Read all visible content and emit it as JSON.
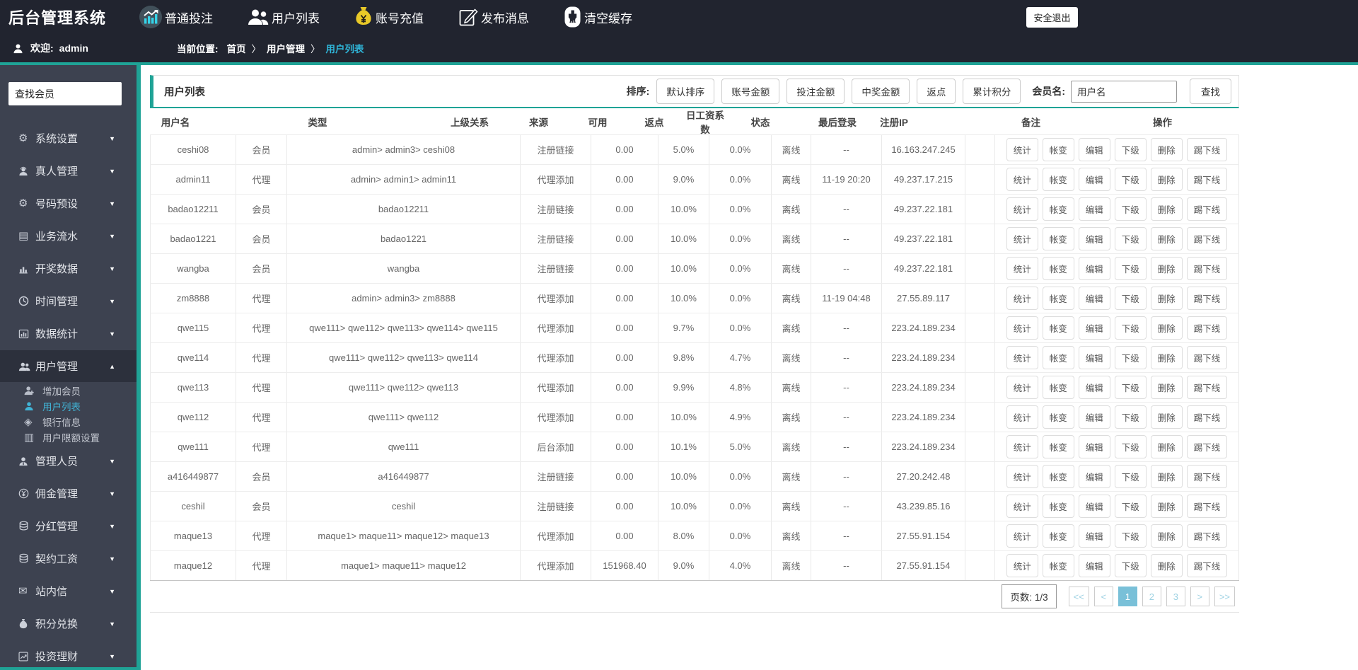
{
  "app": {
    "title": "后台管理系统",
    "logout": "安全退出"
  },
  "topnav": [
    {
      "label": "普通投注",
      "icon": "bet-chart-icon"
    },
    {
      "label": "用户列表",
      "icon": "users-icon"
    },
    {
      "label": "账号充值",
      "icon": "recharge-icon"
    },
    {
      "label": "发布消息",
      "icon": "publish-icon"
    },
    {
      "label": "清空缓存",
      "icon": "cache-icon"
    }
  ],
  "welcome": {
    "icon": "user-icon",
    "label": "欢迎:",
    "user": "admin"
  },
  "breadcrumb": {
    "label": "当前位置:",
    "separator": "〉",
    "items": [
      {
        "label": "首页"
      },
      {
        "label": "用户管理"
      },
      {
        "label": "用户列表",
        "active": true
      }
    ]
  },
  "sidebar": {
    "search_value": "查找会员",
    "menu": [
      {
        "label": "系统设置",
        "icon": "gear-icon",
        "arrow": "▼"
      },
      {
        "label": "真人管理",
        "icon": "live-person-icon",
        "arrow": "▼"
      },
      {
        "label": "号码预设",
        "icon": "gear-outline-icon",
        "arrow": "▼"
      },
      {
        "label": "业务流水",
        "icon": "ledger-icon",
        "arrow": "▼"
      },
      {
        "label": "开奖数据",
        "icon": "podium-chart-icon",
        "arrow": "▼"
      },
      {
        "label": "时间管理",
        "icon": "clock-icon",
        "arrow": "▼"
      },
      {
        "label": "数据统计",
        "icon": "stats-chart-icon",
        "arrow": "▼"
      },
      {
        "label": "用户管理",
        "icon": "people-icon",
        "arrow": "▲",
        "active": true,
        "children": [
          {
            "label": "增加会员",
            "icon": "person-plus-icon"
          },
          {
            "label": "用户列表",
            "icon": "person-icon",
            "active": true
          },
          {
            "label": "银行信息",
            "icon": "bank-diamond-icon"
          },
          {
            "label": "用户限额设置",
            "icon": "doc-limit-icon"
          }
        ]
      },
      {
        "label": "管理人员",
        "icon": "admin-person-icon",
        "arrow": "▼"
      },
      {
        "label": "佣金管理",
        "icon": "yen-circle-icon",
        "arrow": "▼"
      },
      {
        "label": "分红管理",
        "icon": "coins-icon",
        "arrow": "▼"
      },
      {
        "label": "契约工资",
        "icon": "coins2-icon",
        "arrow": "▼"
      },
      {
        "label": "站内信",
        "icon": "mail-icon",
        "arrow": "▼"
      },
      {
        "label": "积分兑换",
        "icon": "moneybag-icon",
        "arrow": "▼"
      },
      {
        "label": "投资理财",
        "icon": "trend-chart-icon",
        "arrow": "▼"
      }
    ]
  },
  "panel": {
    "title": "用户列表",
    "sort_label": "排序:",
    "sort_buttons": [
      "默认排序",
      "账号金额",
      "投注金额",
      "中奖金额",
      "返点",
      "累计积分"
    ],
    "member_label": "会员名:",
    "member_input_value": "用户名",
    "search_button": "查找"
  },
  "table": {
    "columns": [
      "用户名",
      "类型",
      "上级关系",
      "来源",
      "可用",
      "返点",
      "日工资系数",
      "状态",
      "最后登录",
      "注册IP",
      "备注",
      "操作"
    ],
    "action_buttons": [
      "统计",
      "帐变",
      "编辑",
      "下级",
      "删除",
      "踢下线"
    ],
    "rows": [
      [
        "ceshi08",
        "会员",
        "admin> admin3> ceshi08",
        "注册链接",
        "0.00",
        "5.0%",
        "0.0%",
        "离线",
        "--",
        "16.163.247.245",
        ""
      ],
      [
        "admin11",
        "代理",
        "admin> admin1> admin11",
        "代理添加",
        "0.00",
        "9.0%",
        "0.0%",
        "离线",
        "11-19 20:20",
        "49.237.17.215",
        ""
      ],
      [
        "badao12211",
        "会员",
        "badao12211",
        "注册链接",
        "0.00",
        "10.0%",
        "0.0%",
        "离线",
        "--",
        "49.237.22.181",
        ""
      ],
      [
        "badao1221",
        "会员",
        "badao1221",
        "注册链接",
        "0.00",
        "10.0%",
        "0.0%",
        "离线",
        "--",
        "49.237.22.181",
        ""
      ],
      [
        "wangba",
        "会员",
        "wangba",
        "注册链接",
        "0.00",
        "10.0%",
        "0.0%",
        "离线",
        "--",
        "49.237.22.181",
        ""
      ],
      [
        "zm8888",
        "代理",
        "admin> admin3> zm8888",
        "代理添加",
        "0.00",
        "10.0%",
        "0.0%",
        "离线",
        "11-19 04:48",
        "27.55.89.117",
        ""
      ],
      [
        "qwe115",
        "代理",
        "qwe111> qwe112> qwe113> qwe114> qwe115",
        "代理添加",
        "0.00",
        "9.7%",
        "0.0%",
        "离线",
        "--",
        "223.24.189.234",
        ""
      ],
      [
        "qwe114",
        "代理",
        "qwe111> qwe112> qwe113> qwe114",
        "代理添加",
        "0.00",
        "9.8%",
        "4.7%",
        "离线",
        "--",
        "223.24.189.234",
        ""
      ],
      [
        "qwe113",
        "代理",
        "qwe111> qwe112> qwe113",
        "代理添加",
        "0.00",
        "9.9%",
        "4.8%",
        "离线",
        "--",
        "223.24.189.234",
        ""
      ],
      [
        "qwe112",
        "代理",
        "qwe111> qwe112",
        "代理添加",
        "0.00",
        "10.0%",
        "4.9%",
        "离线",
        "--",
        "223.24.189.234",
        ""
      ],
      [
        "qwe111",
        "代理",
        "qwe111",
        "后台添加",
        "0.00",
        "10.1%",
        "5.0%",
        "离线",
        "--",
        "223.24.189.234",
        ""
      ],
      [
        "a416449877",
        "会员",
        "a416449877",
        "注册链接",
        "0.00",
        "10.0%",
        "0.0%",
        "离线",
        "--",
        "27.20.242.48",
        ""
      ],
      [
        "ceshil",
        "会员",
        "ceshil",
        "注册链接",
        "0.00",
        "10.0%",
        "0.0%",
        "离线",
        "--",
        "43.239.85.16",
        ""
      ],
      [
        "maque13",
        "代理",
        "maque1> maque11> maque12> maque13",
        "代理添加",
        "0.00",
        "8.0%",
        "0.0%",
        "离线",
        "--",
        "27.55.91.154",
        ""
      ],
      [
        "maque12",
        "代理",
        "maque1> maque11> maque12",
        "代理添加",
        "151968.40",
        "9.0%",
        "4.0%",
        "离线",
        "--",
        "27.55.91.154",
        ""
      ]
    ]
  },
  "pagination": {
    "page_info": "页数: 1/3",
    "buttons": [
      {
        "label": "<<"
      },
      {
        "label": "<"
      },
      {
        "label": "1",
        "active": true
      },
      {
        "label": "2"
      },
      {
        "label": "3"
      },
      {
        "label": ">"
      },
      {
        "label": ">>"
      }
    ]
  }
}
